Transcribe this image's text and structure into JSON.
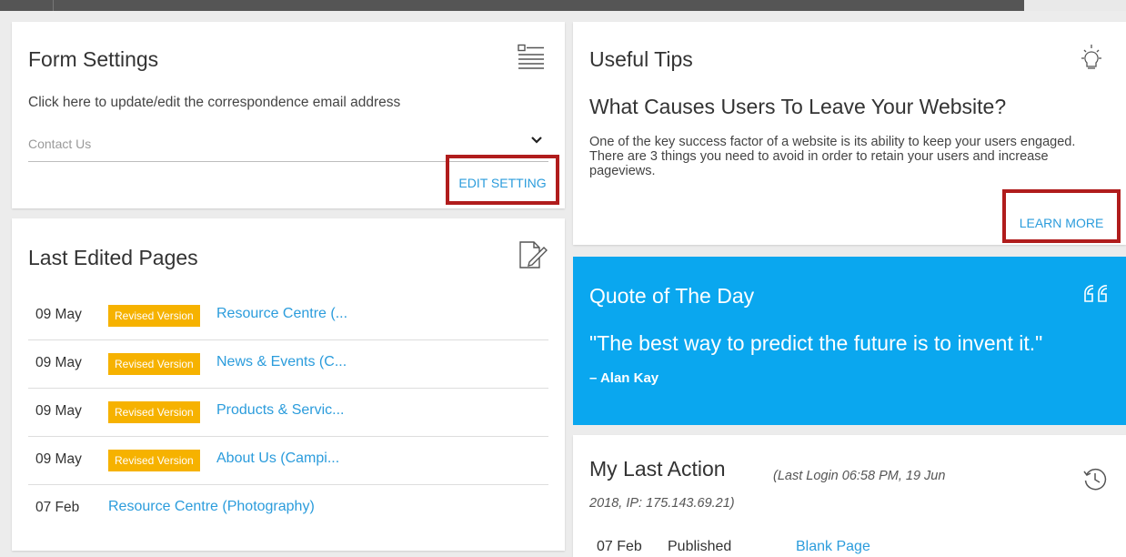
{
  "colors": {
    "accent": "#2b9cdc",
    "badge": "#f6b200",
    "quote_bg": "#0aa7ef",
    "highlight_border": "#b01c1c",
    "topbar": "#555555"
  },
  "form_settings": {
    "title": "Form Settings",
    "icon": "list-icon",
    "description": "Click here to update/edit the correspondence email address",
    "select_value": "Contact Us",
    "button_label": "EDIT SETTING"
  },
  "last_edited": {
    "title": "Last Edited Pages",
    "icon": "edit-document-icon",
    "rows": [
      {
        "date": "09 May",
        "badge": "Revised Version",
        "link": "Resource Centre (..."
      },
      {
        "date": "09 May",
        "badge": "Revised Version",
        "link": "News & Events (C..."
      },
      {
        "date": "09 May",
        "badge": "Revised Version",
        "link": "Products & Servic..."
      },
      {
        "date": "09 May",
        "badge": "Revised Version",
        "link": "About Us (Campi..."
      },
      {
        "date": "07 Feb",
        "badge": "",
        "link": "Resource Centre (Photography)"
      }
    ]
  },
  "useful_tips": {
    "title": "Useful Tips",
    "icon": "lightbulb-icon",
    "heading": "What Causes Users To Leave Your Website?",
    "body": "One of the key success factor of a website is its ability to keep your users engaged. There are 3 things you need to avoid in order to retain your users and increase pageviews.",
    "button_label": "LEARN MORE"
  },
  "quote": {
    "title": "Quote of The Day",
    "icon": "quote-icon",
    "text": "\"The best way to predict the future is to invent it.\"",
    "author": "– Alan Kay"
  },
  "last_action": {
    "title": "My Last Action",
    "meta": "(Last Login 06:58 PM, 19 Jun 2018, IP: 175.143.69.21)",
    "icon": "history-icon",
    "row": {
      "date": "07 Feb",
      "status": "Published",
      "link": "Blank Page"
    }
  }
}
